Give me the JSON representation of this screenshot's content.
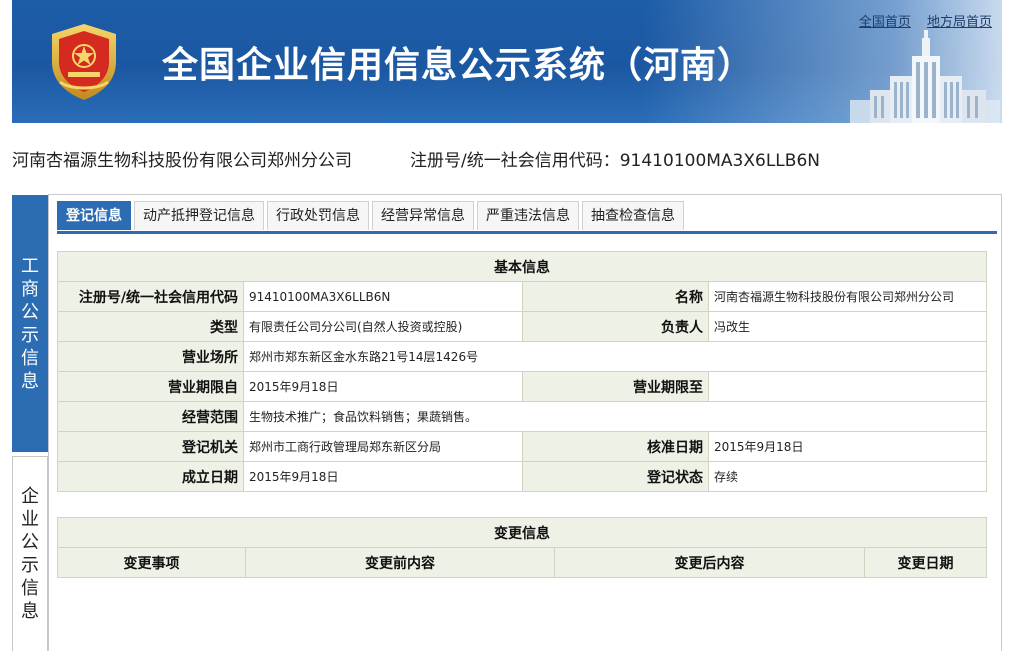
{
  "header": {
    "title": "全国企业信用信息公示系统（河南）",
    "links": [
      "全国首页",
      "地方局首页"
    ],
    "colors": {
      "banner": "#1c5ca8",
      "accent": "#2c6cb3"
    }
  },
  "company": {
    "name": "河南杏福源生物科技股份有限公司郑州分公司",
    "reg_label": "注册号/统一社会信用代码：",
    "reg_code": "91410100MA3X6LLB6N"
  },
  "side_nav": [
    {
      "label": [
        "工",
        "商",
        "公",
        "示",
        "信",
        "息"
      ],
      "active": true
    },
    {
      "label": [
        "企",
        "业",
        "公",
        "示",
        "信",
        "息"
      ],
      "active": false
    }
  ],
  "tabs": [
    "登记信息",
    "动产抵押登记信息",
    "行政处罚信息",
    "经营异常信息",
    "严重违法信息",
    "抽查检查信息"
  ],
  "basic": {
    "caption": "基本信息",
    "rows": [
      {
        "l1": "注册号/统一社会信用代码",
        "v1": "91410100MA3X6LLB6N",
        "l2": "名称",
        "v2": "河南杏福源生物科技股份有限公司郑州分公司"
      },
      {
        "l1": "类型",
        "v1": "有限责任公司分公司(自然人投资或控股)",
        "l2": "负责人",
        "v2": "冯改生"
      },
      {
        "l1": "营业场所",
        "v1": "郑州市郑东新区金水东路21号14层1426号"
      },
      {
        "l1": "营业期限自",
        "v1": "2015年9月18日",
        "l2": "营业期限至",
        "v2": ""
      },
      {
        "l1": "经营范围",
        "v1": "生物技术推广；食品饮料销售；果蔬销售。"
      },
      {
        "l1": "登记机关",
        "v1": "郑州市工商行政管理局郑东新区分局",
        "l2": "核准日期",
        "v2": "2015年9月18日"
      },
      {
        "l1": "成立日期",
        "v1": "2015年9月18日",
        "l2": "登记状态",
        "v2": "存续"
      }
    ]
  },
  "change": {
    "caption": "变更信息",
    "headers": [
      "变更事项",
      "变更前内容",
      "变更后内容",
      "变更日期"
    ]
  }
}
